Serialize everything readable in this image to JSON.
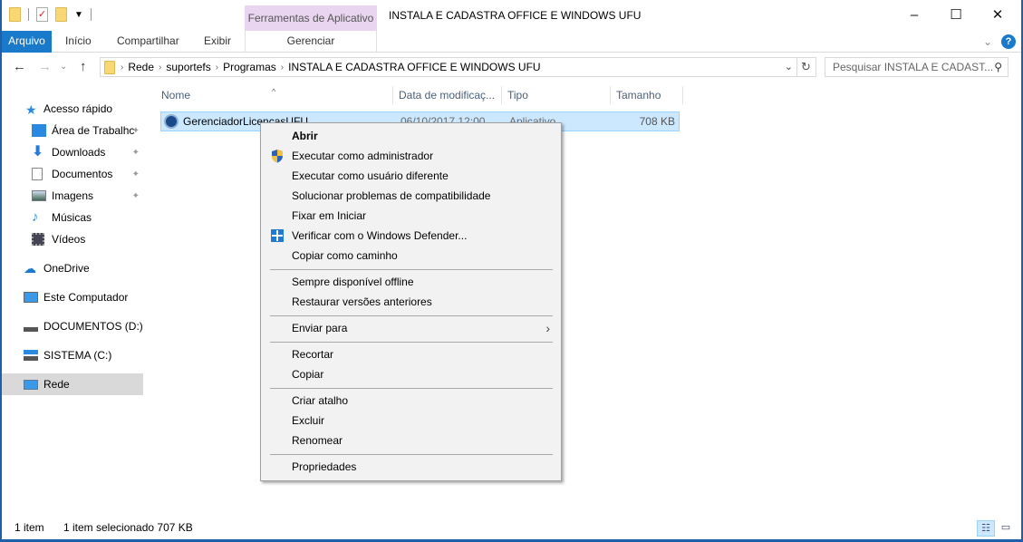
{
  "window": {
    "title": "INSTALA E CADASTRA OFFICE E WINDOWS UFU",
    "contextual_tab_group": "Ferramentas de Aplicativo",
    "controls": {
      "minimize": "–",
      "maximize": "☐",
      "close": "✕"
    }
  },
  "quick_access_toolbar": {
    "icons": [
      "folder-icon",
      "properties-check-icon",
      "new-folder-icon",
      "customize-dropdown-icon"
    ]
  },
  "ribbon": {
    "tabs": [
      {
        "label": "Arquivo",
        "active": true
      },
      {
        "label": "Início"
      },
      {
        "label": "Compartilhar"
      },
      {
        "label": "Exibir"
      }
    ],
    "contextual_tab": "Gerenciar",
    "expand_glyph": "⌄",
    "help_glyph": "?"
  },
  "address_bar": {
    "back": "←",
    "forward": "→",
    "recent": "⌄",
    "up": "↑",
    "breadcrumbs": [
      "Rede",
      "suportefs",
      "Programas",
      "INSTALA E CADASTRA OFFICE E WINDOWS UFU"
    ],
    "separator": "›",
    "dropdown": "⌄",
    "refresh": "↻",
    "search_placeholder": "Pesquisar INSTALA E CADAST...",
    "search_icon": "⚲"
  },
  "navigation_pane": {
    "items": [
      {
        "label": "Acesso rápido",
        "icon": "star-icon",
        "pinned": false
      },
      {
        "label": "Área de Trabalhc",
        "icon": "desktop-icon",
        "pinned": true
      },
      {
        "label": "Downloads",
        "icon": "download-icon",
        "pinned": true
      },
      {
        "label": "Documentos",
        "icon": "documents-icon",
        "pinned": true
      },
      {
        "label": "Imagens",
        "icon": "pictures-icon",
        "pinned": true
      },
      {
        "label": "Músicas",
        "icon": "music-icon",
        "pinned": false
      },
      {
        "label": "Vídeos",
        "icon": "videos-icon",
        "pinned": false
      },
      {
        "label": "OneDrive",
        "icon": "onedrive-icon",
        "pinned": false
      },
      {
        "label": "Este Computador",
        "icon": "computer-icon",
        "pinned": false
      },
      {
        "label": "DOCUMENTOS (D:)",
        "icon": "drive-icon",
        "pinned": false
      },
      {
        "label": "SISTEMA (C:)",
        "icon": "system-drive-icon",
        "pinned": false
      },
      {
        "label": "Rede",
        "icon": "network-icon",
        "pinned": false,
        "selected": true
      }
    ],
    "pin_glyph": "📌"
  },
  "file_list": {
    "columns": [
      "Nome",
      "Data de modificaç...",
      "Tipo",
      "Tamanho"
    ],
    "sort_glyph": "^",
    "rows": [
      {
        "name": "GerenciadorLicencasUFU",
        "modified": "06/10/2017 12:00",
        "type": "Aplicativo",
        "size": "708 KB",
        "selected": true
      }
    ]
  },
  "context_menu": {
    "groups": [
      [
        {
          "label": "Abrir",
          "bold": true
        },
        {
          "label": "Executar como administrador",
          "icon": "uac-shield-icon"
        },
        {
          "label": "Executar como usuário diferente"
        },
        {
          "label": "Solucionar problemas de compatibilidade"
        },
        {
          "label": "Fixar em Iniciar"
        },
        {
          "label": "Verificar com o Windows Defender...",
          "icon": "defender-icon"
        },
        {
          "label": "Copiar como caminho"
        }
      ],
      [
        {
          "label": "Sempre disponível offline"
        },
        {
          "label": "Restaurar versões anteriores"
        }
      ],
      [
        {
          "label": "Enviar para",
          "submenu": true
        }
      ],
      [
        {
          "label": "Recortar"
        },
        {
          "label": "Copiar"
        }
      ],
      [
        {
          "label": "Criar atalho"
        },
        {
          "label": "Excluir"
        },
        {
          "label": "Renomear"
        }
      ],
      [
        {
          "label": "Propriedades"
        }
      ]
    ],
    "submenu_glyph": "›"
  },
  "status_bar": {
    "item_count": "1 item",
    "selection": "1 item selecionado  707 KB",
    "view_details_glyph": "☷",
    "view_thumbs_glyph": "▭"
  }
}
